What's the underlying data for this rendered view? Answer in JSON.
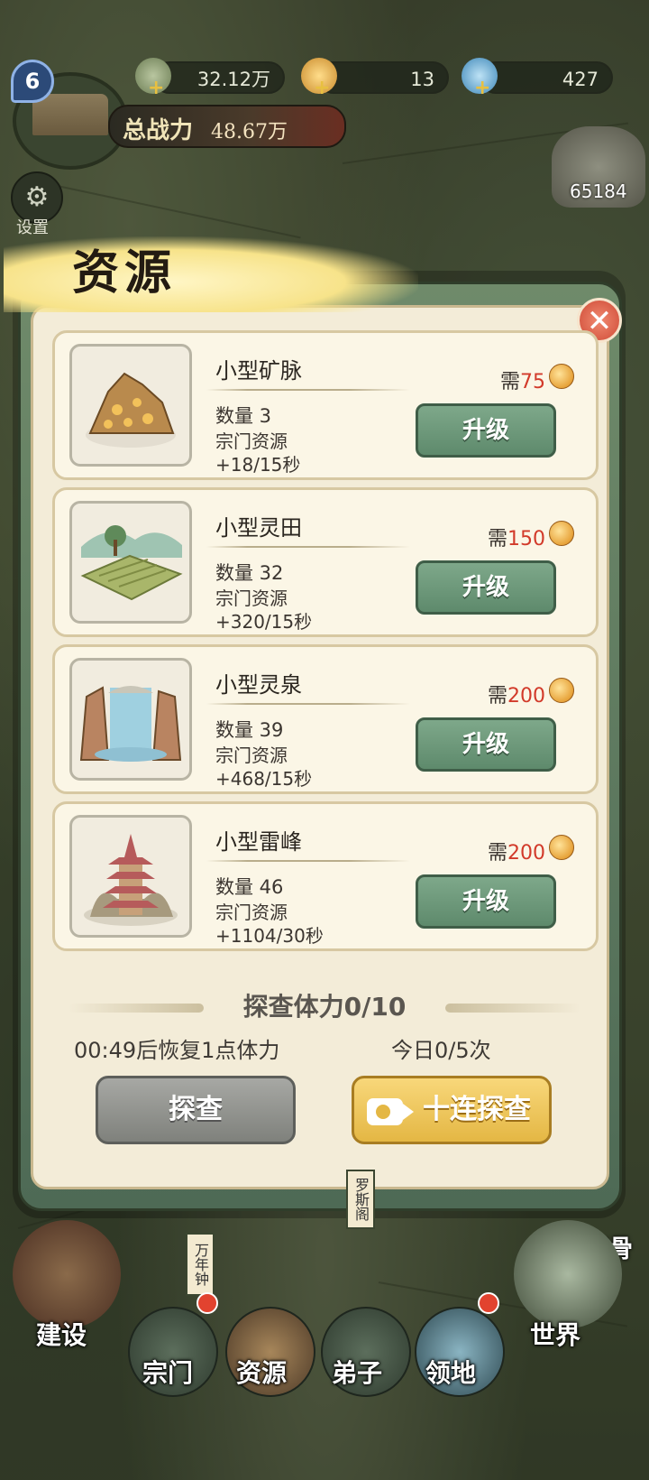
{
  "hud": {
    "level": "6",
    "power_label": "总战力",
    "power_value": "48.67万",
    "resources": [
      {
        "icon": "spirit-stone-icon",
        "value": "32.12万"
      },
      {
        "icon": "gold-ingot-icon",
        "value": "13"
      },
      {
        "icon": "crystal-icon",
        "value": "427"
      }
    ],
    "bag_value": "65184",
    "settings_label": "设置"
  },
  "dialog": {
    "title": "资源",
    "close_symbol": "✕",
    "cost_prefix": "需",
    "upgrade_label": "升级",
    "type_label": "宗门资源",
    "items": [
      {
        "name": "小型矿脉",
        "quantity": "数量 3",
        "rate": "+18/15秒",
        "cost": "75",
        "image": "mine-image"
      },
      {
        "name": "小型灵田",
        "quantity": "数量 32",
        "rate": "+320/15秒",
        "cost": "150",
        "image": "field-image"
      },
      {
        "name": "小型灵泉",
        "quantity": "数量 39",
        "rate": "+468/15秒",
        "cost": "200",
        "image": "spring-image"
      },
      {
        "name": "小型雷峰",
        "quantity": "数量 46",
        "rate": "+1104/30秒",
        "cost": "200",
        "image": "pagoda-image"
      }
    ],
    "stamina_title": "探查体力0/10",
    "recover_text": "00:49后恢复1点体力",
    "daily_text": "今日0/5次",
    "explore_label": "探查",
    "ten_explore_label": "十连探查"
  },
  "bottom_nav": {
    "right_label": "打敷筋骨",
    "map_tags": [
      "罗斯阁",
      "万年钟"
    ],
    "items": [
      {
        "label": "建设"
      },
      {
        "label": "宗门"
      },
      {
        "label": "资源"
      },
      {
        "label": "弟子"
      },
      {
        "label": "领地"
      },
      {
        "label": "世界"
      }
    ]
  },
  "colors": {
    "panel": "#f3ecd8",
    "upgrade_button": "#6e9a7c",
    "cost_number": "#d23a2a",
    "ten_button": "#e9c052"
  }
}
